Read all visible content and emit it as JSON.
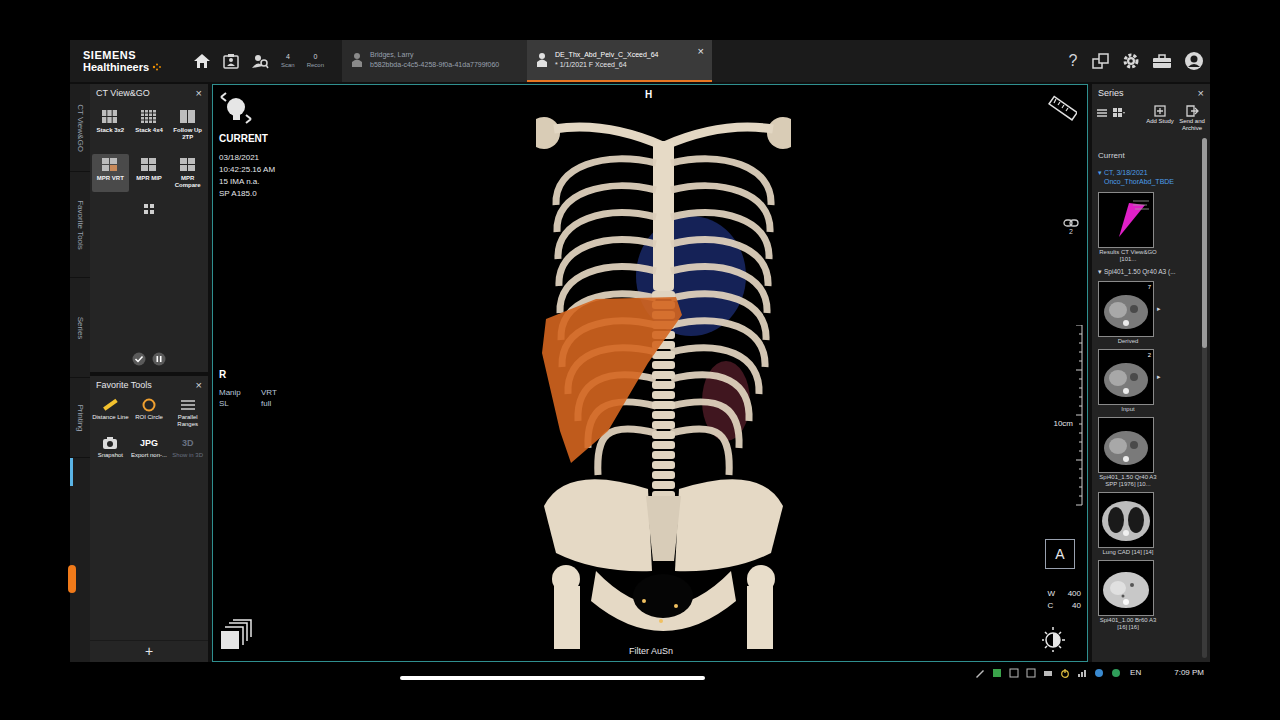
{
  "app": {
    "logo": {
      "brand": "SIEMENS",
      "sub": "Healthineers"
    },
    "counters": [
      {
        "value": "4",
        "label": "Scan"
      },
      {
        "value": "0",
        "label": "Recon"
      }
    ],
    "tabs": [
      {
        "title": "Bridges, Larry",
        "subtitle": "b582bbda-c4c5-4258-9f0a-41da7799f060",
        "selected": false
      },
      {
        "title": "DE_Thx_Abd_Pelv_C_Xceed_64",
        "subtitle": "* 1/1/2021 F Xceed_64",
        "selected": true
      }
    ],
    "tab_close": "×",
    "help": "?"
  },
  "side_tabs": [
    "CT View&GO",
    "Favorite Tools",
    "Series",
    "Printing"
  ],
  "view_go": {
    "title": "CT View&GO",
    "close": "×",
    "layouts": [
      {
        "label": "Stack 3x2",
        "selected": false
      },
      {
        "label": "Stack 4x4",
        "selected": false
      },
      {
        "label": "Follow Up 2TP",
        "selected": false
      },
      {
        "label": "MPR VRT",
        "selected": true
      },
      {
        "label": "MPR MIP",
        "selected": false
      },
      {
        "label": "MPR Compare",
        "selected": false
      }
    ]
  },
  "favorite_tools": {
    "title": "Favorite Tools",
    "close": "×",
    "add": "+",
    "tools": [
      {
        "kind": "ruler",
        "label": "Distance Line",
        "disabled": false
      },
      {
        "kind": "circle",
        "label": "ROI Circle",
        "disabled": false
      },
      {
        "kind": "ranges",
        "label": "Parallel Ranges",
        "disabled": false
      },
      {
        "kind": "camera",
        "label": "Snapshot",
        "disabled": false
      },
      {
        "kind": "text",
        "glyph": "JPG",
        "label": "Export non-...",
        "disabled": false
      },
      {
        "kind": "text",
        "glyph": "3D",
        "label": "Show in 3D",
        "disabled": true
      }
    ]
  },
  "viewport": {
    "header": "CURRENT",
    "info": [
      "03/18/2021",
      "10:42:25.16 AM",
      "15 IMA n.a.",
      "SP A185.0"
    ],
    "top": "H",
    "left": "R",
    "mode": [
      [
        "Manip",
        "VRT"
      ],
      [
        "SL",
        "full"
      ]
    ],
    "scale": "10cm",
    "orientation": "A",
    "link": "2",
    "window": [
      [
        "W",
        "400"
      ],
      [
        "C",
        "40"
      ]
    ],
    "filter": "Filter AuSn"
  },
  "series": {
    "title": "Series",
    "close": "×",
    "actions": [
      "Add Study",
      "Send and Archive"
    ],
    "section": "Current",
    "study": {
      "expander": "▾",
      "lines": [
        "CT, 3/18/2021",
        "Onco_ThorAbd_TBDE"
      ]
    },
    "result": {
      "label": "Results CT View&GO [101..."
    },
    "group": {
      "expander": "▾",
      "label": "Spi401_1.50 Qr40 A3 (..."
    },
    "items": [
      {
        "kind": "soft",
        "label": "Derived",
        "count": "7",
        "expand": "▸"
      },
      {
        "kind": "soft",
        "label": "Input",
        "count": "2",
        "expand": "▸"
      },
      {
        "kind": "soft",
        "label": "Spi401_1.50 Qr40 A3 SPP [1976] [10..."
      },
      {
        "kind": "lung",
        "label": "Lung CAD [14] [14]"
      },
      {
        "kind": "bright",
        "label": "Spi401_1.00 Br60 A3 [16] [16]"
      }
    ]
  },
  "taskbar": {
    "lang": "EN",
    "time": "7:09 PM"
  }
}
